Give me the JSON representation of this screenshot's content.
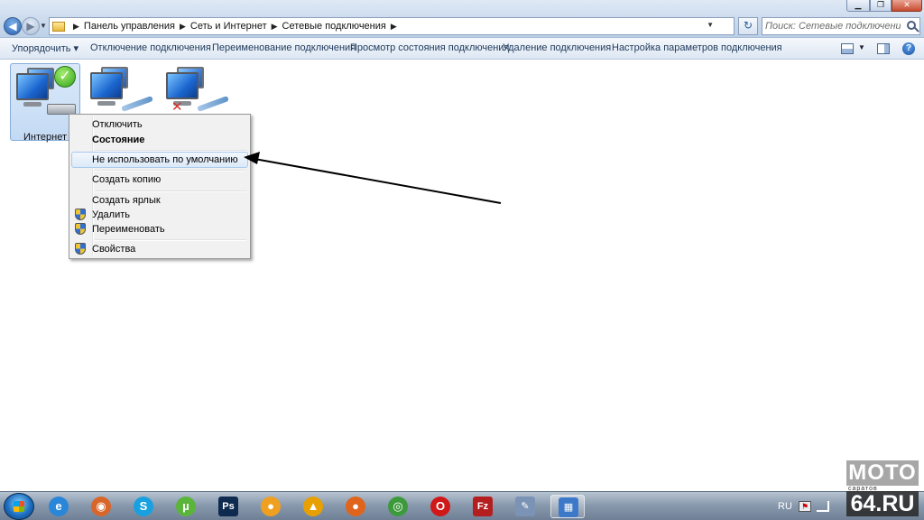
{
  "address_bar": {
    "crumbs": [
      "Панель управления",
      "Сеть и Интернет",
      "Сетевые подключения"
    ]
  },
  "search": {
    "placeholder": "Поиск: Сетевые подключения"
  },
  "command_bar": {
    "organize": "Упорядочить ▾",
    "disable": "Отключение подключения",
    "rename": "Переименование подключения",
    "status": "Просмотр состояния подключения",
    "delete": "Удаление подключения",
    "settings": "Настройка параметров подключения"
  },
  "connections": [
    {
      "label": "Интернет",
      "state": "connected",
      "icon": "network-connected-icon"
    },
    {
      "label": "",
      "state": "network-cable",
      "icon": "network-icon"
    },
    {
      "label": "",
      "state": "disconnected",
      "icon": "network-disconnected-icon"
    }
  ],
  "context_menu": {
    "items": [
      {
        "label": "Отключить",
        "bold": false,
        "shield": false
      },
      {
        "label": "Состояние",
        "bold": true,
        "shield": false
      },
      {
        "label": "Не использовать по умолчанию",
        "bold": false,
        "shield": false,
        "hovered": true
      },
      {
        "label": "Создать копию",
        "bold": false,
        "shield": false
      },
      {
        "label": "Создать ярлык",
        "bold": false,
        "shield": false
      },
      {
        "label": "Удалить",
        "bold": false,
        "shield": true
      },
      {
        "label": "Переименовать",
        "bold": false,
        "shield": true
      },
      {
        "label": "Свойства",
        "bold": false,
        "shield": true
      }
    ]
  },
  "taskbar": {
    "apps": [
      {
        "name": "internet-explorer-icon",
        "color": "#2a86d8",
        "glyph": "e"
      },
      {
        "name": "media-player-icon",
        "color": "#d8662a",
        "glyph": "◉"
      },
      {
        "name": "skype-icon",
        "color": "#18a0e0",
        "glyph": "S"
      },
      {
        "name": "utorrent-icon",
        "color": "#5ab53a",
        "glyph": "µ"
      },
      {
        "name": "photoshop-icon",
        "color": "#0e2a4f",
        "glyph": "Ps"
      },
      {
        "name": "aimp-icon",
        "color": "#f0a020",
        "glyph": "●"
      },
      {
        "name": "aimp-player-icon",
        "color": "#e8a000",
        "glyph": "▲"
      },
      {
        "name": "firefox-icon",
        "color": "#e0641c",
        "glyph": "●"
      },
      {
        "name": "chrome-icon",
        "color": "#3c9a3c",
        "glyph": "◎"
      },
      {
        "name": "opera-icon",
        "color": "#d01818",
        "glyph": "O"
      },
      {
        "name": "filezilla-icon",
        "color": "#b41e1e",
        "glyph": "Fz"
      },
      {
        "name": "notepad-icon",
        "color": "#7b93b5",
        "glyph": "✎"
      },
      {
        "name": "network-connections-icon",
        "color": "#3d79c8",
        "glyph": "▦"
      }
    ],
    "language": "RU"
  },
  "watermark": {
    "top": "МОТО",
    "middle": "саратов",
    "bottom": "64.RU"
  }
}
